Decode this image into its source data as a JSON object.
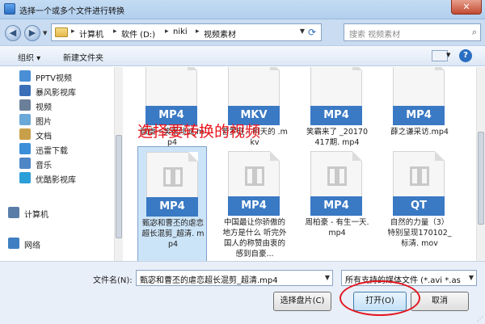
{
  "window": {
    "title": "选择一个或多个文件进行转换",
    "close": "✕"
  },
  "nav": {
    "breadcrumbs": [
      "计算机",
      "软件 (D:)",
      "niki",
      "视频素材"
    ],
    "search_placeholder": "搜索 视频素材"
  },
  "toolbar": {
    "organize": "组织 ▾",
    "new_folder": "新建文件夹"
  },
  "sidebar": {
    "items": [
      {
        "label": "PPTV视频",
        "icon": "pptv-icon",
        "color": "#4a8fd6"
      },
      {
        "label": "暴风影视库",
        "icon": "baofeng-icon",
        "color": "#3a6fb8"
      },
      {
        "label": "视频",
        "icon": "video-library-icon",
        "color": "#6b7f99"
      },
      {
        "label": "图片",
        "icon": "pictures-library-icon",
        "color": "#6aa8d8"
      },
      {
        "label": "文档",
        "icon": "documents-library-icon",
        "color": "#c9a04a"
      },
      {
        "label": "迅雷下载",
        "icon": "xunlei-icon",
        "color": "#3b8fd8"
      },
      {
        "label": "音乐",
        "icon": "music-library-icon",
        "color": "#4f86c6"
      },
      {
        "label": "优酷影视库",
        "icon": "youku-icon",
        "color": "#2b9fd8"
      },
      {
        "label": "计算机",
        "icon": "computer-icon",
        "color": "#5a7da8"
      },
      {
        "label": "网络",
        "icon": "network-icon",
        "color": "#3f7fc2"
      }
    ]
  },
  "files": [
    {
      "badge": "MP4",
      "name": "微微一笑很倾城.mp4",
      "selected": false
    },
    {
      "badge": "MKV",
      "name": "普罗旺 - 明天的 .mkv",
      "selected": false
    },
    {
      "badge": "MP4",
      "name": "笑霸来了 _20170417期. mp4",
      "selected": false
    },
    {
      "badge": "MP4",
      "name": "薛之谦采访.mp4",
      "selected": false
    },
    {
      "badge": "MP4",
      "name": "甄宓和曹丕的虐恋超长混剪_超清. mp4",
      "selected": true
    },
    {
      "badge": "MP4",
      "name": "中国最让你骄傲的地方是什么 听完外国人的称赞由衷的感到自豪...",
      "selected": false
    },
    {
      "badge": "MP4",
      "name": "周柏豪 - 有生一天.mp4",
      "selected": false
    },
    {
      "badge": "QT",
      "name": "自然的力量（3）特别呈现170102_标清. mov",
      "selected": false
    }
  ],
  "annotation": "选择要转换的视频",
  "footer": {
    "filename_label": "文件名(N):",
    "filename_value": "甄宓和曹丕的虐恋超长混剪_超清.mp4",
    "filetype_value": "所有支持的媒体文件 (*.avi *.as",
    "pick_button": "选择盘片(C)",
    "open_button": "打开(O)",
    "cancel_button": "取消"
  }
}
